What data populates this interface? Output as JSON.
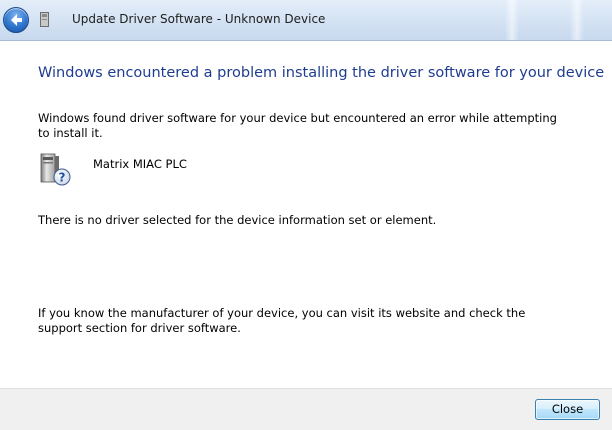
{
  "window": {
    "title": "Update Driver Software - Unknown Device"
  },
  "main": {
    "headline": "Windows encountered a problem installing the driver software for your device",
    "description": "Windows found driver software for your device but encountered an error while attempting to install it.",
    "device_name": "Matrix MIAC PLC",
    "error_message": "There is no driver selected for the device information set or element.",
    "help_text": "If you know the manufacturer of your device, you can visit its website and check the support section for driver software."
  },
  "footer": {
    "close_label": "Close"
  },
  "icons": {
    "back": "back-arrow-icon",
    "device_small": "device-icon",
    "device_unknown": "unknown-device-icon"
  }
}
